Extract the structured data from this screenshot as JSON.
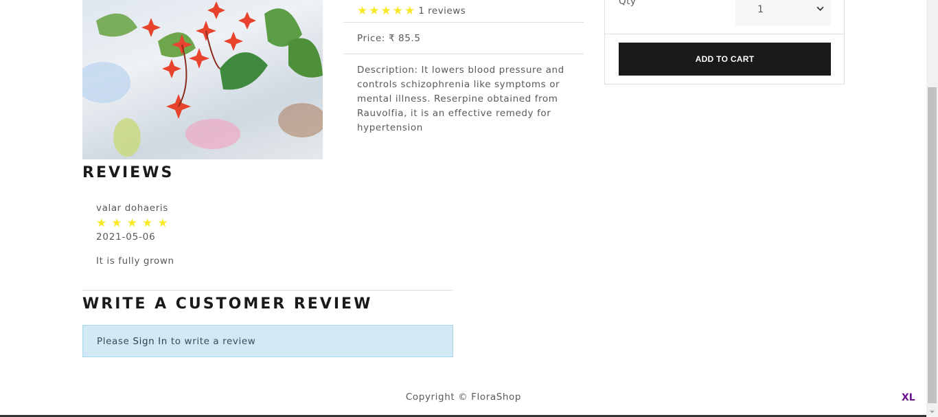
{
  "product": {
    "rating_count_text": "1 reviews",
    "rating": 5,
    "price_text": "Price: ₹ 85.5",
    "description_text": "Description: It lowers blood pressure and controls schizophrenia like symptoms or mental illness. Reserpine obtained from Rauvolfia, it is an effective remedy for hypertension"
  },
  "cart": {
    "qty_label": "Qty",
    "qty_value": "1",
    "add_to_cart_label": "ADD TO CART"
  },
  "reviews": {
    "title": "REVIEWS",
    "items": [
      {
        "name": "valar dohaeris",
        "rating": 5,
        "date": "2021-05-06",
        "comment": "It is fully grown"
      }
    ]
  },
  "write_review": {
    "title": "WRITE A CUSTOMER REVIEW",
    "prefix": "Please",
    "link": "Sign In",
    "suffix": "to write a review"
  },
  "footer": {
    "copyright": "Copyright © FloraShop"
  },
  "badge": {
    "label": "XL"
  },
  "colors": {
    "star": "#f8e825",
    "button": "#1a1a1a",
    "alert_bg": "#d1e9f4",
    "badge": "#6a0f8e"
  }
}
